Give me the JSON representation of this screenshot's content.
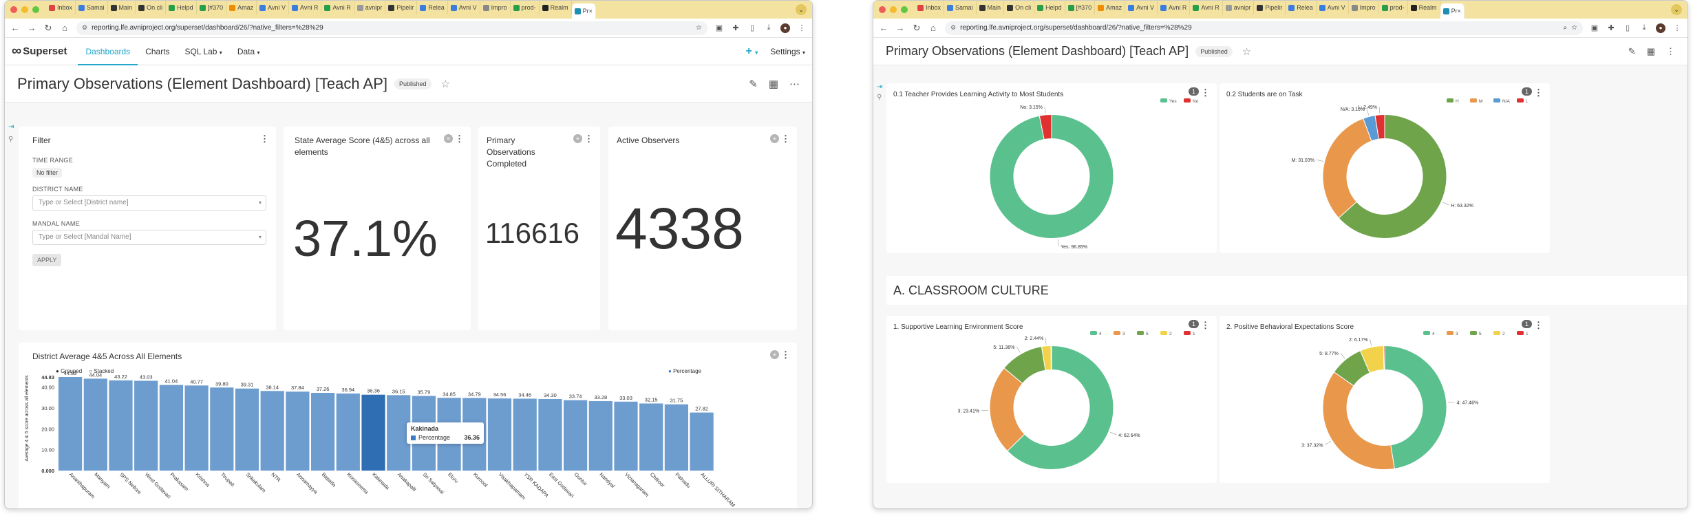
{
  "left_window": {
    "tabs": [
      "Inbox",
      "Samai",
      "Main",
      "On cli",
      "Helpd",
      "[#370",
      "Amaz",
      "Avni V",
      "Avni R",
      "Avni R",
      "avnipr",
      "Pipelir",
      "Relea",
      "Avni V",
      "Impro",
      "prod-",
      "Realm",
      "Pr"
    ],
    "url": "reporting.lfe.avniproject.org/superset/dashboard/26/?native_filters=%28%29",
    "nav": {
      "logo": "Superset",
      "dashboards": "Dashboards",
      "charts": "Charts",
      "sqllab": "SQL Lab",
      "data": "Data",
      "settings": "Settings"
    },
    "dashboard": {
      "title": "Primary Observations (Element Dashboard) [Teach AP]",
      "status": "Published"
    },
    "filter": {
      "title": "Filter",
      "time_label": "TIME RANGE",
      "time_value": "No filter",
      "district_label": "DISTRICT NAME",
      "district_placeholder": "Type or Select [District name]",
      "mandal_label": "MANDAL NAME",
      "mandal_placeholder": "Type or Select [Mandal Name]",
      "apply": "APPLY"
    },
    "kpis": [
      {
        "title": "State Average Score (4&5) across all elements",
        "value": "37.1%"
      },
      {
        "title": "Primary Observations Completed",
        "value": "116616"
      },
      {
        "title": "Active Observers",
        "value": "4338"
      }
    ],
    "bar_chart": {
      "title": "District Average 4&5 Across All Elements",
      "grouped": "Grouped",
      "stacked": "Stacked",
      "legend": "Percentage",
      "ylabel": "Average 4 & 5 score across all elements",
      "tooltip_title": "Kakinada",
      "tooltip_label": "Percentage",
      "tooltip_value": "36.36"
    }
  },
  "right_window": {
    "url": "reporting.lfe.avniproject.org/superset/dashboard/26/?native_filters=%28%29",
    "dashboard": {
      "title": "Primary Observations (Element Dashboard) [Teach AP]",
      "status": "Published"
    },
    "section_title": "A. CLASSROOM CULTURE",
    "badge": "1",
    "pies": [
      {
        "title": "0.1 Teacher Provides Learning Activity to Most Students"
      },
      {
        "title": "0.2 Students are on Task"
      },
      {
        "title": "1. Supportive Learning Environment Score"
      },
      {
        "title": "2. Positive Behavioral Expectations Score"
      }
    ]
  },
  "chart_data": [
    {
      "type": "bar",
      "title": "District Average 4&5 Across All Elements",
      "ylabel": "Average 4 & 5 score across all elements",
      "yticks": [
        "0.000",
        "10.00",
        "20.00",
        "30.00",
        "40.00",
        "44.83"
      ],
      "ylim": [
        0,
        44.83
      ],
      "series": [
        {
          "name": "Percentage",
          "values": [
            44.83,
            44.04,
            43.22,
            43.03,
            41.04,
            40.77,
            39.8,
            39.31,
            38.14,
            37.84,
            37.26,
            36.94,
            36.36,
            36.15,
            35.79,
            34.85,
            34.79,
            34.56,
            34.46,
            34.3,
            33.74,
            33.28,
            33.03,
            32.15,
            31.75,
            27.82
          ]
        }
      ],
      "categories": [
        "Ananthapuram",
        "Manyam",
        "SPS Nellore",
        "West Godavari",
        "Prakasam",
        "Krishna",
        "Tirupati",
        "Srikakulam",
        "NTR",
        "Annamayya",
        "Bapatla",
        "Konaseema",
        "Kakinada",
        "Anakapalli",
        "Sri Satyasai",
        "Eluru",
        "Kurnool",
        "Visakhapatnam",
        "YSR KADAPA",
        "East Godavari",
        "Guntur",
        "Nandyal",
        "Vizianagaram",
        "Chittoor",
        "Palnadu",
        "ALLURI SITHARAM"
      ],
      "color": "#6d9ccf",
      "highlight_color": "#2f6eb2"
    },
    {
      "type": "pie",
      "title": "0.1 Teacher Provides Learning Activity to Most Students",
      "labels": [
        "Yes",
        "No"
      ],
      "values": [
        96.85,
        3.15
      ],
      "data_labels": [
        "Yes: 96.85%",
        "No: 3.15%"
      ],
      "colors": [
        "#5ac18e",
        "#e03131"
      ]
    },
    {
      "type": "pie",
      "title": "0.2 Students are on Task",
      "labels": [
        "H",
        "M",
        "N/A",
        "L"
      ],
      "values": [
        63.32,
        31.03,
        3.16,
        2.49
      ],
      "data_labels": [
        "H: 63.32%",
        "M: 31.03%",
        "N/A: 3.16%",
        "L: 2.49%"
      ],
      "colors": [
        "#6fa44b",
        "#e8974b",
        "#5b9bd5",
        "#e03131"
      ]
    },
    {
      "type": "pie",
      "title": "1. Supportive Learning Environment Score",
      "labels": [
        "4",
        "3",
        "5",
        "2",
        "1"
      ],
      "values": [
        62.64,
        23.41,
        11.36,
        2.44,
        0.15
      ],
      "data_labels": [
        "4: 62.64%",
        "3: 23.41%",
        "5: 11.36%",
        "2: 2.44%"
      ],
      "colors": [
        "#5ac18e",
        "#e8974b",
        "#6fa44b",
        "#f2d24a",
        "#e03131"
      ]
    },
    {
      "type": "pie",
      "title": "2. Positive Behavioral Expectations Score",
      "labels": [
        "4",
        "3",
        "5",
        "2",
        "1"
      ],
      "values": [
        47.46,
        37.32,
        8.77,
        6.17,
        0.28
      ],
      "data_labels": [
        "4: 47.46%",
        "3: 37.32%",
        "5: 8.77%",
        "2: 6.17%"
      ],
      "colors": [
        "#5ac18e",
        "#e8974b",
        "#6fa44b",
        "#f2d24a",
        "#e03131"
      ]
    }
  ]
}
